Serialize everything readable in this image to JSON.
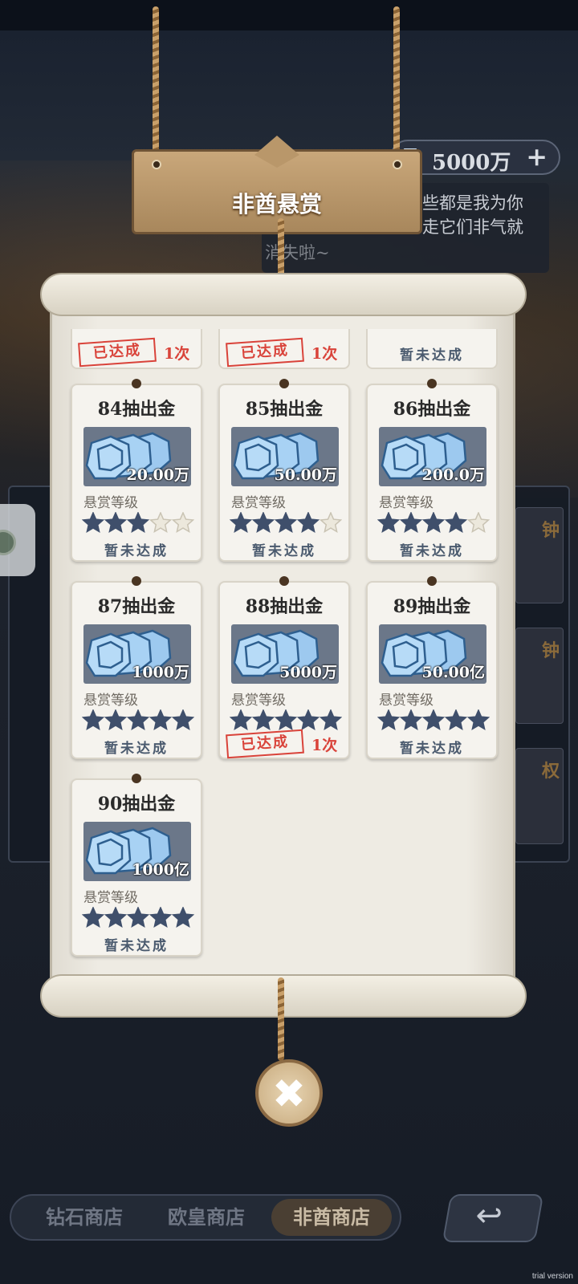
{
  "currency": {
    "amount": "5000万",
    "plus": "+",
    "icon": "diamond-gem-icon"
  },
  "speech": {
    "line1": "些都是我为你",
    "line2": "走它们非气就",
    "line3": "消失啦~"
  },
  "sign": {
    "title": "非酋悬赏"
  },
  "partial_row": [
    {
      "stamp": "已达成",
      "count": "1次",
      "achieved": true
    },
    {
      "stamp": "已达成",
      "count": "1次",
      "achieved": true
    },
    {
      "status": "暂未达成",
      "achieved": false
    }
  ],
  "cards": [
    {
      "title": "84抽出金",
      "amount": "20.00万",
      "level_label": "悬赏等级",
      "stars": 3,
      "status": "暂未达成",
      "achieved": false
    },
    {
      "title": "85抽出金",
      "amount": "50.00万",
      "level_label": "悬赏等级",
      "stars": 4,
      "status": "暂未达成",
      "achieved": false
    },
    {
      "title": "86抽出金",
      "amount": "200.0万",
      "level_label": "悬赏等级",
      "stars": 4,
      "status": "暂未达成",
      "achieved": false
    },
    {
      "title": "87抽出金",
      "amount": "1000万",
      "level_label": "悬赏等级",
      "stars": 5,
      "status": "暂未达成",
      "achieved": false
    },
    {
      "title": "88抽出金",
      "amount": "5000万",
      "level_label": "悬赏等级",
      "stars": 5,
      "stamp": "已达成",
      "count": "1次",
      "achieved": true
    },
    {
      "title": "89抽出金",
      "amount": "50.00亿",
      "level_label": "悬赏等级",
      "stars": 5,
      "status": "暂未达成",
      "achieved": false
    },
    {
      "title": "90抽出金",
      "amount": "1000亿",
      "level_label": "悬赏等级",
      "stars": 5,
      "status": "暂未达成",
      "achieved": false
    }
  ],
  "max_stars": 5,
  "colors": {
    "star_filled": "#3f4f6b",
    "star_empty": "#ece8dc",
    "stamp_red": "#d9433a"
  },
  "close_button": {
    "symbol": "✖",
    "icon": "close-icon"
  },
  "tabs": [
    {
      "label": "钻石商店",
      "active": false
    },
    {
      "label": "欧皇商店",
      "active": false
    },
    {
      "label": "非酋商店",
      "active": true
    }
  ],
  "back_button": {
    "symbol": "↩",
    "icon": "back-arrow-icon"
  },
  "watermark": "trial version"
}
